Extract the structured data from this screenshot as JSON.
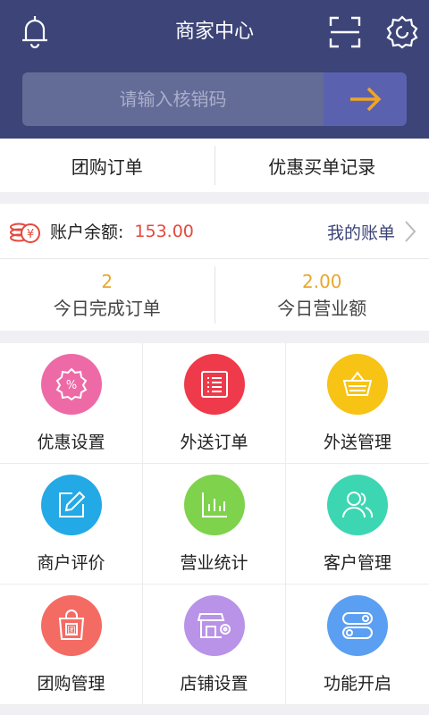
{
  "header": {
    "title": "商家中心",
    "icons": [
      "bell-icon",
      "scan-icon",
      "settings-icon"
    ],
    "search": {
      "placeholder": "请输入核销码",
      "value": ""
    }
  },
  "tabs": [
    {
      "label": "团购订单"
    },
    {
      "label": "优惠买单记录"
    }
  ],
  "account": {
    "label": "账户余额:",
    "balance": "153.00",
    "link_label": "我的账单"
  },
  "stats": [
    {
      "value": "2",
      "label": "今日完成订单"
    },
    {
      "value": "2.00",
      "label": "今日营业额"
    }
  ],
  "menu": [
    {
      "label": "优惠设置",
      "icon": "discount-icon",
      "color": "#ee6aa7"
    },
    {
      "label": "外送订单",
      "icon": "order-list-icon",
      "color": "#ee3a4a"
    },
    {
      "label": "外送管理",
      "icon": "basket-icon",
      "color": "#f7c314"
    },
    {
      "label": "商户评价",
      "icon": "edit-icon",
      "color": "#22a9e6"
    },
    {
      "label": "营业统计",
      "icon": "bar-chart-icon",
      "color": "#7ed24c"
    },
    {
      "label": "客户管理",
      "icon": "users-icon",
      "color": "#3dd6b2"
    },
    {
      "label": "团购管理",
      "icon": "group-bag-icon",
      "color": "#f46b64"
    },
    {
      "label": "店铺设置",
      "icon": "shop-icon",
      "color": "#b893e8"
    },
    {
      "label": "功能开启",
      "icon": "toggle-icon",
      "color": "#5b9ff2"
    }
  ],
  "colors": {
    "header_bg": "#3c4478",
    "accent_orange": "#f0a424",
    "balance_red": "#e5483d",
    "stat_yellow": "#e8a72a"
  }
}
